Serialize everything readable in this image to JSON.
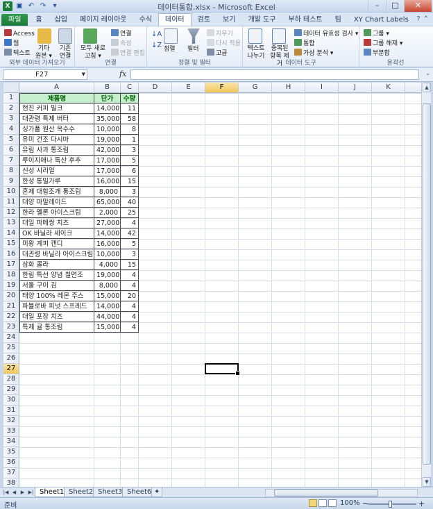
{
  "window": {
    "title": "데이터통합.xlsx - Microsoft Excel",
    "controls": [
      "–",
      "□",
      "✕"
    ]
  },
  "tabs": [
    {
      "label": "파일",
      "active": false
    },
    {
      "label": "홈",
      "active": false
    },
    {
      "label": "삽입",
      "active": false
    },
    {
      "label": "페이지 레이아웃",
      "active": false
    },
    {
      "label": "수식",
      "active": false
    },
    {
      "label": "데이터",
      "active": true
    },
    {
      "label": "검토",
      "active": false
    },
    {
      "label": "보기",
      "active": false
    },
    {
      "label": "개발 도구",
      "active": false
    },
    {
      "label": "부하 테스트",
      "active": false
    },
    {
      "label": "팀",
      "active": false
    },
    {
      "label": "XY Chart Labels",
      "active": false
    }
  ],
  "ribbon": {
    "external_data": {
      "label": "외부 데이터 가져오기",
      "access": "Access",
      "web": "웹",
      "text": "텍스트",
      "other_sources": "기타 원본 ▾",
      "existing": "기존 연결"
    },
    "connections": {
      "label": "연결",
      "refresh_all": "모두 새로 고침 ▾",
      "connections": "연결",
      "properties": "속성",
      "edit_links": "연결 편집"
    },
    "sort_filter": {
      "label": "정렬 및 필터",
      "sort": "정렬",
      "filter": "필터",
      "clear": "지우기",
      "reapply": "다시 적용",
      "advanced": "고급"
    },
    "data_tools": {
      "label": "데이터 도구",
      "text_to_columns": "텍스트 나누기",
      "remove_duplicates": "중복된 항목 제거",
      "validation": "데이터 유효성 검사 ▾",
      "consolidate": "통합",
      "what_if": "가상 분석 ▾"
    },
    "outline": {
      "label": "윤곽선",
      "group": "그룹 ▾",
      "ungroup": "그룹 해제 ▾",
      "subtotal": "부분합"
    }
  },
  "formula_bar": {
    "name_box": "F27",
    "fx": "fx",
    "formula": ""
  },
  "columns": [
    "A",
    "B",
    "C",
    "D",
    "E",
    "F",
    "G",
    "H",
    "I",
    "J",
    "K"
  ],
  "selected_column": "F",
  "selected_row": 27,
  "row_numbers": [
    "1",
    "2",
    "3",
    "4",
    "5",
    "6",
    "7",
    "8",
    "9",
    "10",
    "11",
    "12",
    "13",
    "14",
    "15",
    "16",
    "17",
    "18",
    "19",
    "20",
    "21",
    "22",
    "23",
    "24",
    "25",
    "26",
    "27",
    "28",
    "29",
    "30",
    "31",
    "32",
    "33",
    "34",
    "35",
    "36",
    "37",
    "38"
  ],
  "table": {
    "headers": [
      "제품명",
      "단가",
      "수량"
    ],
    "rows": [
      [
        "현진 커피 밀크",
        "14,000",
        "11"
      ],
      [
        "대관령 특제 버터",
        "35,000",
        "58"
      ],
      [
        "싱가폴 원산 옥수수",
        "10,000",
        "8"
      ],
      [
        "유미 건조 다시마",
        "19,000",
        "1"
      ],
      [
        "유림 사과 통조림",
        "42,000",
        "3"
      ],
      [
        "루이지애나 특산 후추",
        "17,000",
        "5"
      ],
      [
        "신성 시리얼",
        "17,000",
        "6"
      ],
      [
        "한성 통밀가루",
        "16,000",
        "15"
      ],
      [
        "혼제 대합조개 통조림",
        "8,000",
        "3"
      ],
      [
        "대양 마말레이드",
        "65,000",
        "40"
      ],
      [
        "한라 멜론 아이스크림",
        "2,000",
        "25"
      ],
      [
        "대일 파메쌍 치즈",
        "27,000",
        "4"
      ],
      [
        "OK 바닐라 셰이크",
        "14,000",
        "42"
      ],
      [
        "미왕 계피 캔디",
        "16,000",
        "5"
      ],
      [
        "대관령 바닐라 아이스크림",
        "10,000",
        "3"
      ],
      [
        "삼화 콜라",
        "4,000",
        "15"
      ],
      [
        "한림 특선 양념 칠면조",
        "19,000",
        "4"
      ],
      [
        "서울 구이 김",
        "8,000",
        "4"
      ],
      [
        "태양 100% 레몬 주스",
        "15,000",
        "20"
      ],
      [
        "파블로바 피넛 스프레드",
        "14,000",
        "4"
      ],
      [
        "대일 포장 치즈",
        "44,000",
        "4"
      ],
      [
        "특제 귤 통조림",
        "15,000",
        "4"
      ]
    ]
  },
  "sheets": [
    "Sheet1",
    "Sheet2",
    "Sheet3",
    "Sheet6"
  ],
  "active_sheet": "Sheet1",
  "status": {
    "ready": "준비",
    "zoom": "100%"
  },
  "colors": {
    "header_fill": "#c6efce",
    "header_text": "#006100",
    "file_tab": "#1d7a38",
    "selection": "#000000"
  }
}
